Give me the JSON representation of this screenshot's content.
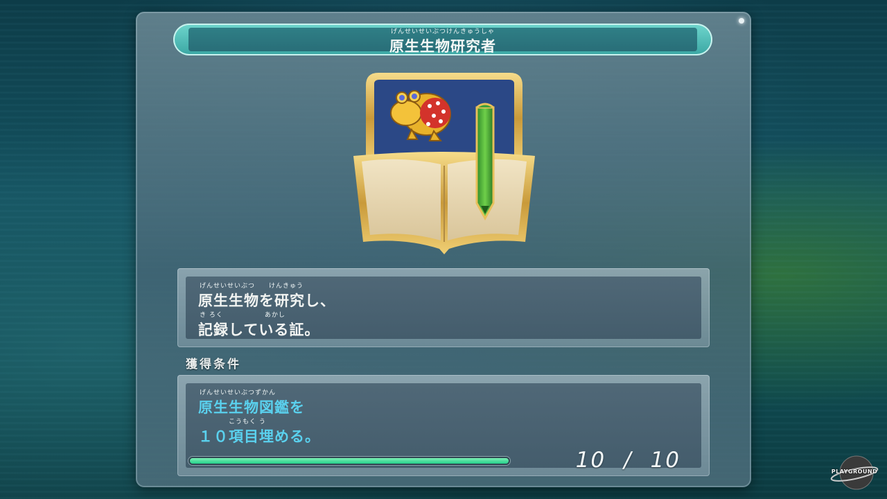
{
  "title": {
    "ruby": "げんせいせいぶつけんきゅうしゃ",
    "text": "原生生物研究者"
  },
  "emblem": {
    "icon": "frog-notebook-pencil-badge-icon"
  },
  "description": {
    "line1": {
      "ruby": "げんせいせいぶつ　　けんきゅう",
      "text": "原生生物を研究し、"
    },
    "line2": {
      "ruby": "き ろく　　　　　　あかし",
      "text": "記録している証。"
    }
  },
  "condition": {
    "label": "獲得条件",
    "line1": {
      "ruby": "げんせいせいぶつずかん",
      "text": "原生生物図鑑を"
    },
    "line2": {
      "ruby": "こうもく う",
      "text": "１０項目埋める。"
    },
    "progress": {
      "current": "10",
      "separator": "/",
      "total": "10",
      "fraction": 1.0
    }
  },
  "watermark": {
    "text": "PLAYGROUND"
  },
  "colors": {
    "title_accent": "#3aa6a3",
    "condition_text": "#5ad1ee",
    "progress_fill": "#25d08c"
  }
}
